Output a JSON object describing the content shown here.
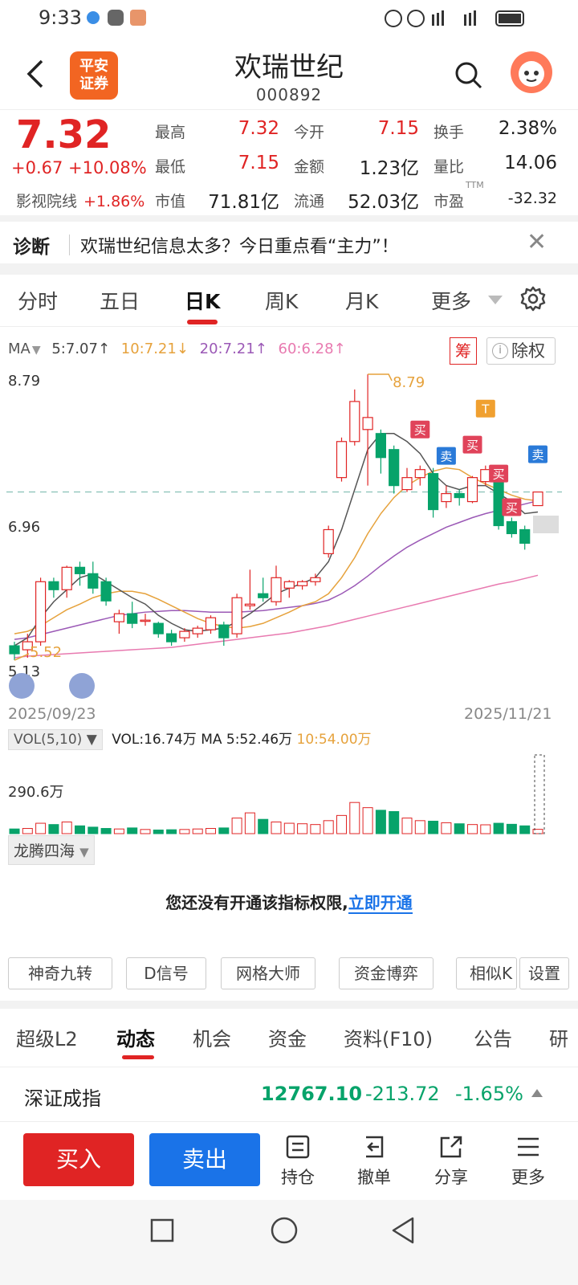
{
  "status_bar": {
    "time": "9:33"
  },
  "header": {
    "title": "欢瑞世纪",
    "code": "000892",
    "logo_text": "平安\n证券"
  },
  "quote": {
    "price": "7.32",
    "change": "+0.67 +10.08%",
    "sector_name": "影视院线",
    "sector_change": "+1.86%",
    "fields": [
      {
        "label": "最高",
        "value": "7.32"
      },
      {
        "label": "今开",
        "value": "7.15"
      },
      {
        "label": "换手",
        "value": "2.38%"
      },
      {
        "label": "最低",
        "value": "7.15"
      },
      {
        "label": "金额",
        "value": "1.23亿"
      },
      {
        "label": "量比",
        "value": "14.06"
      },
      {
        "label": "市值",
        "value": "71.81亿"
      },
      {
        "label": "流通",
        "value": "52.03亿"
      },
      {
        "label": "市盈",
        "value": "-32.32"
      }
    ],
    "ttm": "TTM"
  },
  "diagnosis": {
    "label": "诊断",
    "text": "欢瑞世纪信息太多？今日重点看“主力”！"
  },
  "chart_tabs": [
    "分时",
    "五日",
    "日K",
    "周K",
    "月K",
    "更多"
  ],
  "ma": {
    "label": "MA",
    "ma5": "5:7.07↑",
    "ma10": "10:7.21↓",
    "ma20": "20:7.21↑",
    "ma60": "60:6.28↑",
    "chou": "筹",
    "chuquan": "除权"
  },
  "axis": {
    "top": "8.79",
    "mid": "6.96",
    "bottom": "5.13",
    "high_label": "8.79",
    "low_label": "5.52",
    "start_date": "2025/09/23",
    "end_date": "2025/11/21"
  },
  "signals": {
    "buy": "买",
    "sell": "卖",
    "t": "T"
  },
  "volume": {
    "indicator": "VOL(5,10)",
    "vol": "VOL:16.74万",
    "ma5": "MA 5:52.46万",
    "ma10": "10:54.00万",
    "axis_top": "290.6万"
  },
  "indicator_button": "龙腾四海",
  "permission": {
    "text": "您还没有开通该指标权限,",
    "link": "立即开通"
  },
  "chips": [
    "神奇九转",
    "D信号",
    "网格大师",
    "资金博弈",
    "相似K",
    "设置"
  ],
  "bottom_tabs": [
    "超级L2",
    "动态",
    "机会",
    "资金",
    "资料(F10)",
    "公告",
    "研"
  ],
  "index": {
    "name": "深证成指",
    "value": "12767.10",
    "change": "-213.72",
    "pct": "-1.65%"
  },
  "actions": {
    "buy": "买入",
    "sell": "卖出",
    "hold": "持仓",
    "cancel": "撤单",
    "share": "分享",
    "more": "更多"
  },
  "colors": {
    "up": "#e02424",
    "down": "#07a36a",
    "accent": "#1a73e8",
    "ma5": "#555555",
    "ma10": "#e6a23c",
    "ma20": "#9b59b6",
    "ma60": "#e87ab0"
  },
  "chart_data": {
    "type": "candlestick",
    "ylim": [
      5.13,
      8.79
    ],
    "candles": [
      {
        "o": 5.4,
        "c": 5.3,
        "h": 5.45,
        "l": 5.22
      },
      {
        "o": 5.35,
        "c": 5.45,
        "h": 5.55,
        "l": 5.25
      },
      {
        "o": 5.45,
        "c": 6.2,
        "h": 6.25,
        "l": 5.4
      },
      {
        "o": 6.2,
        "c": 6.1,
        "h": 6.25,
        "l": 6.0
      },
      {
        "o": 6.1,
        "c": 6.38,
        "h": 6.4,
        "l": 6.0
      },
      {
        "o": 6.38,
        "c": 6.3,
        "h": 6.45,
        "l": 6.15
      },
      {
        "o": 6.3,
        "c": 6.12,
        "h": 6.45,
        "l": 6.05
      },
      {
        "o": 6.2,
        "c": 5.96,
        "h": 6.25,
        "l": 5.9
      },
      {
        "o": 5.7,
        "c": 5.8,
        "h": 5.85,
        "l": 5.55
      },
      {
        "o": 5.8,
        "c": 5.68,
        "h": 5.95,
        "l": 5.62
      },
      {
        "o": 5.72,
        "c": 5.72,
        "h": 5.8,
        "l": 5.65
      },
      {
        "o": 5.68,
        "c": 5.55,
        "h": 5.7,
        "l": 5.5
      },
      {
        "o": 5.55,
        "c": 5.45,
        "h": 5.6,
        "l": 5.4
      },
      {
        "o": 5.5,
        "c": 5.58,
        "h": 5.62,
        "l": 5.45
      },
      {
        "o": 5.55,
        "c": 5.62,
        "h": 5.65,
        "l": 5.5
      },
      {
        "o": 5.6,
        "c": 5.75,
        "h": 5.78,
        "l": 5.55
      },
      {
        "o": 5.66,
        "c": 5.5,
        "h": 5.7,
        "l": 5.4
      },
      {
        "o": 5.55,
        "c": 6.0,
        "h": 6.05,
        "l": 5.5
      },
      {
        "o": 5.9,
        "c": 5.92,
        "h": 6.35,
        "l": 5.85
      },
      {
        "o": 6.05,
        "c": 6.0,
        "h": 6.25,
        "l": 5.95
      },
      {
        "o": 5.95,
        "c": 6.25,
        "h": 6.4,
        "l": 5.9
      },
      {
        "o": 6.12,
        "c": 6.2,
        "h": 6.22,
        "l": 6.0
      },
      {
        "o": 6.15,
        "c": 6.2,
        "h": 6.22,
        "l": 6.1
      },
      {
        "o": 6.2,
        "c": 6.25,
        "h": 6.3,
        "l": 6.15
      },
      {
        "o": 6.55,
        "c": 6.85,
        "h": 6.9,
        "l": 6.5
      },
      {
        "o": 7.5,
        "c": 7.95,
        "h": 8.0,
        "l": 7.45
      },
      {
        "o": 7.95,
        "c": 8.45,
        "h": 8.6,
        "l": 7.9
      },
      {
        "o": 8.1,
        "c": 8.25,
        "h": 8.79,
        "l": 7.4
      },
      {
        "o": 8.05,
        "c": 7.75,
        "h": 8.1,
        "l": 7.55
      },
      {
        "o": 7.85,
        "c": 7.4,
        "h": 7.9,
        "l": 7.3
      },
      {
        "o": 7.35,
        "c": 7.5,
        "h": 7.62,
        "l": 7.32
      },
      {
        "o": 7.5,
        "c": 7.6,
        "h": 7.65,
        "l": 7.4
      },
      {
        "o": 7.55,
        "c": 7.1,
        "h": 7.62,
        "l": 7.0
      },
      {
        "o": 7.2,
        "c": 7.3,
        "h": 7.4,
        "l": 7.12
      },
      {
        "o": 7.3,
        "c": 7.25,
        "h": 7.35,
        "l": 7.15
      },
      {
        "o": 7.2,
        "c": 7.5,
        "h": 7.52,
        "l": 7.18
      },
      {
        "o": 7.45,
        "c": 7.6,
        "h": 7.65,
        "l": 7.4
      },
      {
        "o": 7.55,
        "c": 6.9,
        "h": 7.6,
        "l": 6.85
      },
      {
        "o": 6.95,
        "c": 6.8,
        "h": 7.0,
        "l": 6.75
      },
      {
        "o": 6.85,
        "c": 6.68,
        "h": 6.9,
        "l": 6.6
      },
      {
        "o": 7.15,
        "c": 7.32,
        "h": 7.32,
        "l": 7.15
      }
    ],
    "ma5": [
      5.4,
      5.5,
      5.75,
      5.95,
      6.1,
      6.25,
      6.3,
      6.2,
      6.1,
      6.0,
      5.92,
      5.78,
      5.68,
      5.6,
      5.58,
      5.6,
      5.62,
      5.7,
      5.8,
      5.92,
      6.05,
      6.12,
      6.18,
      6.25,
      6.45,
      6.85,
      7.35,
      7.85,
      8.05,
      8.05,
      7.95,
      7.8,
      7.55,
      7.4,
      7.35,
      7.4,
      7.4,
      7.3,
      7.2,
      7.05,
      7.07
    ],
    "ma10": [
      5.55,
      5.58,
      5.65,
      5.75,
      5.85,
      5.92,
      6.0,
      6.05,
      6.08,
      6.08,
      6.05,
      5.98,
      5.9,
      5.82,
      5.74,
      5.68,
      5.64,
      5.62,
      5.64,
      5.68,
      5.75,
      5.82,
      5.9,
      5.95,
      6.05,
      6.25,
      6.5,
      6.8,
      7.05,
      7.25,
      7.4,
      7.5,
      7.58,
      7.62,
      7.6,
      7.5,
      7.42,
      7.35,
      7.28,
      7.23,
      7.21
    ],
    "ma20": [
      5.48,
      5.5,
      5.54,
      5.58,
      5.62,
      5.66,
      5.7,
      5.74,
      5.78,
      5.8,
      5.82,
      5.83,
      5.84,
      5.84,
      5.83,
      5.82,
      5.82,
      5.82,
      5.83,
      5.84,
      5.86,
      5.88,
      5.9,
      5.93,
      5.97,
      6.05,
      6.15,
      6.27,
      6.4,
      6.52,
      6.63,
      6.72,
      6.8,
      6.88,
      6.94,
      7.0,
      7.05,
      7.09,
      7.13,
      7.17,
      7.21
    ],
    "ma60": [
      5.25,
      5.27,
      5.28,
      5.29,
      5.3,
      5.31,
      5.32,
      5.33,
      5.34,
      5.35,
      5.36,
      5.37,
      5.38,
      5.4,
      5.42,
      5.44,
      5.46,
      5.48,
      5.5,
      5.52,
      5.54,
      5.56,
      5.59,
      5.62,
      5.65,
      5.69,
      5.73,
      5.77,
      5.81,
      5.85,
      5.89,
      5.93,
      5.97,
      6.01,
      6.05,
      6.09,
      6.13,
      6.17,
      6.2,
      6.24,
      6.28
    ],
    "volume": [
      18,
      20,
      40,
      35,
      45,
      30,
      25,
      20,
      18,
      22,
      16,
      14,
      15,
      16,
      18,
      20,
      22,
      60,
      80,
      55,
      45,
      40,
      38,
      35,
      50,
      70,
      120,
      100,
      90,
      85,
      60,
      50,
      48,
      42,
      38,
      35,
      34,
      40,
      36,
      30,
      16.74
    ],
    "volume_max": 290.6
  }
}
